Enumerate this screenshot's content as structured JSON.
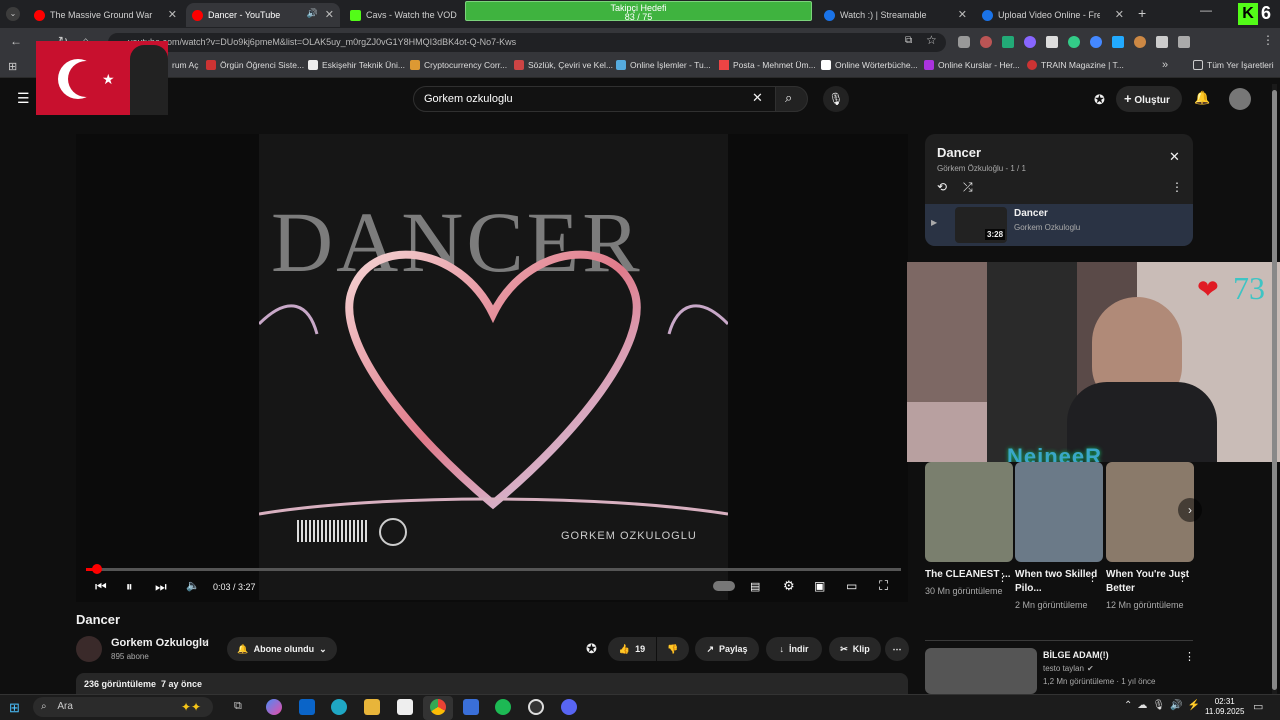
{
  "tabs": [
    {
      "title": "The Massive Ground War in Am",
      "color": "#ff0000"
    },
    {
      "title": "Dancer - YouTube",
      "color": "#ff0000"
    },
    {
      "title": "Cavs - Watch the VOD on Ki",
      "color": "#53fc18"
    },
    {
      "title": "Watch :) | Streamable",
      "color": "#1a73e8"
    },
    {
      "title": "Upload Video Online - Free Vi",
      "color": "#1a73e8"
    }
  ],
  "overlay": {
    "follow_label": "Takipçi Hedefi",
    "follow_count": "83 / 75",
    "kick_count": "6",
    "hearts": "73",
    "cam_name": "NeineeR"
  },
  "address": {
    "url": "youtube.com/watch?v=DUo9kj6pmeM&list=OLAK5uy_m0rgZJ0vG1Y8HMQI3dBK4ot-Q-No7-Kws"
  },
  "bookmarks": [
    "rum Aç",
    "Örgün Öğrenci Siste...",
    "Eskişehir Teknik Üni...",
    "Cryptocurrency Corr...",
    "Sözlük, Çeviri ve Kel...",
    "Online İşlemler - Tu...",
    "Posta - Mehmet Üm...",
    "Online Wörterbüche...",
    "Online Kurslar - Her...",
    "TRAIN Magazine | T..."
  ],
  "bookmarks_all": "Tüm Yer İşaretleri",
  "yt": {
    "search_value": "Gorkem ozkuloglu",
    "create_label": "Oluştur"
  },
  "player": {
    "cover_title": "DANCER",
    "cover_artist": "GORKEM OZKULOGLU",
    "time": "0:03 / 3:27",
    "progress": 0.015
  },
  "video": {
    "title": "Dancer",
    "channel": "Gorkem Ozkuloglu",
    "subs": "895 abone",
    "subscribed": "Abone olundu",
    "likes": "19",
    "share": "Paylaş",
    "download": "İndir",
    "clip": "Klip",
    "views": "236 görüntüleme  7 ay önce"
  },
  "playlist": {
    "title": "Dancer",
    "meta": "Görkem Özkuloğlu - 1 / 1",
    "item_title": "Dancer",
    "item_artist": "Gorkem Ozkuloglu",
    "item_duration": "3:28"
  },
  "recs": [
    {
      "title": "The CLEANEST ...",
      "views": "30 Mn görüntüleme"
    },
    {
      "title": "When two Skilled Pilo...",
      "views": "2 Mn görüntüleme"
    },
    {
      "title": "When You're Just Better",
      "views": "12 Mn görüntüleme"
    }
  ],
  "rec_list": {
    "title": "BİLGE ADAM(!)",
    "channel": "testo taylan",
    "meta": "1,2 Mn görüntüleme · 1 yıl önce"
  },
  "taskbar": {
    "search": "Ara",
    "time": "02:31",
    "date": "11.09.2025"
  }
}
